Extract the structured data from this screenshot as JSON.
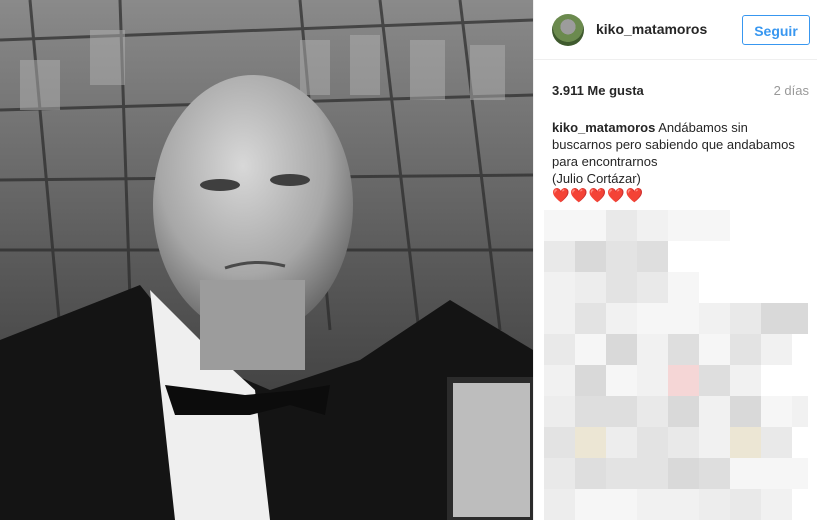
{
  "post": {
    "username": "kiko_matamoros",
    "follow_label": "Seguir",
    "likes": "3.911 Me gusta",
    "time_ago": "2 días",
    "caption_username": "kiko_matamoros",
    "caption_text": "Andábamos sin buscarnos pero sabiendo que andabamos para encontrarnos",
    "caption_attribution": "(Julio Cortázar)",
    "caption_hearts": "❤️❤️❤️❤️❤️"
  },
  "colors": {
    "accent": "#3897f0",
    "text": "#262626",
    "muted": "#999999"
  },
  "icons": {
    "avatar": "profile-picture"
  }
}
